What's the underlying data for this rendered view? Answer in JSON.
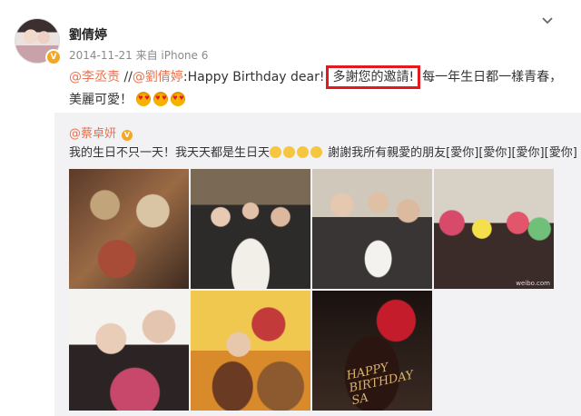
{
  "post": {
    "username": "劉倩婷",
    "date": "2014-11-21",
    "source": "来自 iPhone 6",
    "text_mention1": "@李丞责",
    "text_sep": " //",
    "text_mention2": "@劉倩婷",
    "text_body1": ":Happy Birthday dear!",
    "text_highlight": "多謝您的邀請!",
    "text_body2": "每一年生日都一樣青春，美麗可愛！",
    "emoji_count": 3
  },
  "repost": {
    "username": "@蔡卓妍",
    "text_part1": "我的生日不只一天！我天天都是生日天",
    "text_part2": "謝謝我所有親愛的朋友",
    "love_tags": [
      "[愛你]",
      "[愛你]",
      "[愛你]",
      "[愛你]"
    ],
    "watermark": "weibo.com",
    "cake_text": "HAPPY BIRTHDAY SA"
  },
  "colors": {
    "link": "#eb7350",
    "highlight_border": "#e3191f",
    "repost_bg": "#f2f2f5",
    "badge": "#f5a623"
  }
}
